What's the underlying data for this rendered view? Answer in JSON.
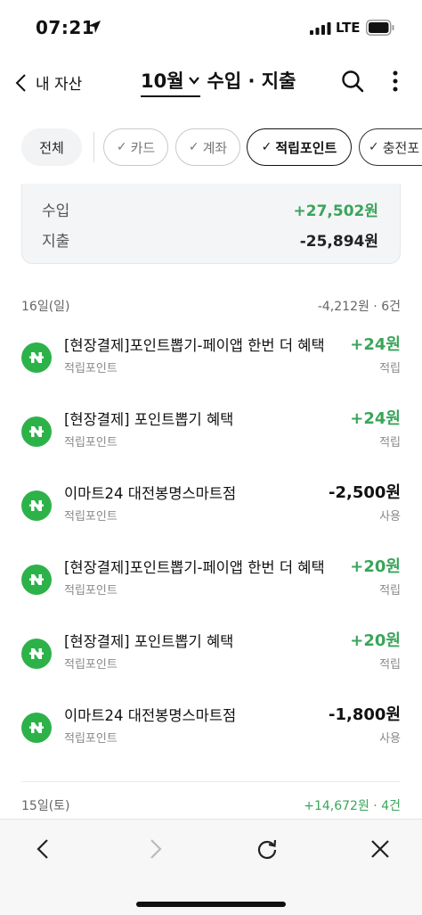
{
  "status_bar": {
    "time": "07:21",
    "network": "LTE"
  },
  "header": {
    "back_label": "내 자산",
    "month": "10월",
    "title_rest": "수입 · 지출"
  },
  "filters": {
    "all": "전체",
    "card": "카드",
    "account": "계좌",
    "points": "적립포인트",
    "charge": "충전포",
    "selected": "적립포인트"
  },
  "summary": {
    "income_label": "수입",
    "income_value": "+27,502원",
    "expense_label": "지출",
    "expense_value": "-25,894원"
  },
  "days": [
    {
      "date": "16일(일)",
      "meta": "-4,212원 · 6건",
      "transactions": [
        {
          "name": "[현장결제]포인트뽑기-페이앱 한번 더 혜택",
          "category": "적립포인트",
          "amount": "+24원",
          "type": "적립"
        },
        {
          "name": "[현장결제] 포인트뽑기 혜택",
          "category": "적립포인트",
          "amount": "+24원",
          "type": "적립"
        },
        {
          "name": "이마트24 대전봉명스마트점",
          "category": "적립포인트",
          "amount": "-2,500원",
          "type": "사용"
        },
        {
          "name": "[현장결제]포인트뽑기-페이앱 한번 더 혜택",
          "category": "적립포인트",
          "amount": "+20원",
          "type": "적립"
        },
        {
          "name": "[현장결제] 포인트뽑기 혜택",
          "category": "적립포인트",
          "amount": "+20원",
          "type": "적립"
        },
        {
          "name": "이마트24 대전봉명스마트점",
          "category": "적립포인트",
          "amount": "-1,800원",
          "type": "사용"
        }
      ]
    },
    {
      "date": "15일(토)",
      "meta": "+14,672원 · 4건"
    }
  ],
  "colors": {
    "positive": "#3aa55a",
    "icon_bg": "#2db24a",
    "text": "#111111",
    "muted": "#8a8a8a"
  },
  "icons": {
    "status": [
      "location-arrow-icon",
      "signal-icon",
      "battery-icon"
    ],
    "header": [
      "back-chevron-icon",
      "chevron-down-icon",
      "search-icon",
      "more-vertical-icon"
    ],
    "transaction": "naver-pay-icon",
    "toolbar": [
      "back-icon",
      "forward-icon",
      "reload-icon",
      "close-icon"
    ]
  }
}
